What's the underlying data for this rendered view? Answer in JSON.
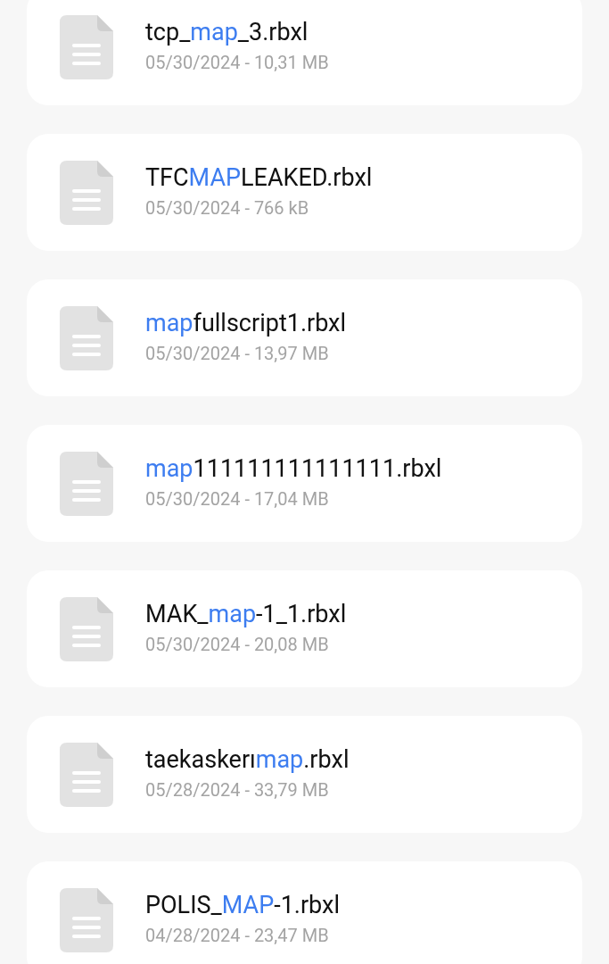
{
  "files": [
    {
      "name": [
        {
          "text": "tcp_",
          "match": false
        },
        {
          "text": "map",
          "match": true
        },
        {
          "text": "_3.rbxl",
          "match": false
        }
      ],
      "details": "05/30/2024 - 10,31 MB"
    },
    {
      "name": [
        {
          "text": "TFC",
          "match": false
        },
        {
          "text": "MAP",
          "match": true
        },
        {
          "text": "LEAKED.rbxl",
          "match": false
        }
      ],
      "details": "05/30/2024 - 766 kB"
    },
    {
      "name": [
        {
          "text": "map",
          "match": true
        },
        {
          "text": "fullscript1.rbxl",
          "match": false
        }
      ],
      "details": "05/30/2024 - 13,97 MB"
    },
    {
      "name": [
        {
          "text": "map",
          "match": true
        },
        {
          "text": "111111111111111.rbxl",
          "match": false
        }
      ],
      "details": "05/30/2024 - 17,04 MB"
    },
    {
      "name": [
        {
          "text": "MAK_",
          "match": false
        },
        {
          "text": "map",
          "match": true
        },
        {
          "text": "-1_1.rbxl",
          "match": false
        }
      ],
      "details": "05/30/2024 - 20,08 MB"
    },
    {
      "name": [
        {
          "text": "taekaskerı",
          "match": false
        },
        {
          "text": "map",
          "match": true
        },
        {
          "text": ".rbxl",
          "match": false
        }
      ],
      "details": "05/28/2024 - 33,79 MB"
    },
    {
      "name": [
        {
          "text": "POLIS_",
          "match": false
        },
        {
          "text": "MAP",
          "match": true
        },
        {
          "text": "-1.rbxl",
          "match": false
        }
      ],
      "details": "04/28/2024 - 23,47 MB"
    }
  ]
}
